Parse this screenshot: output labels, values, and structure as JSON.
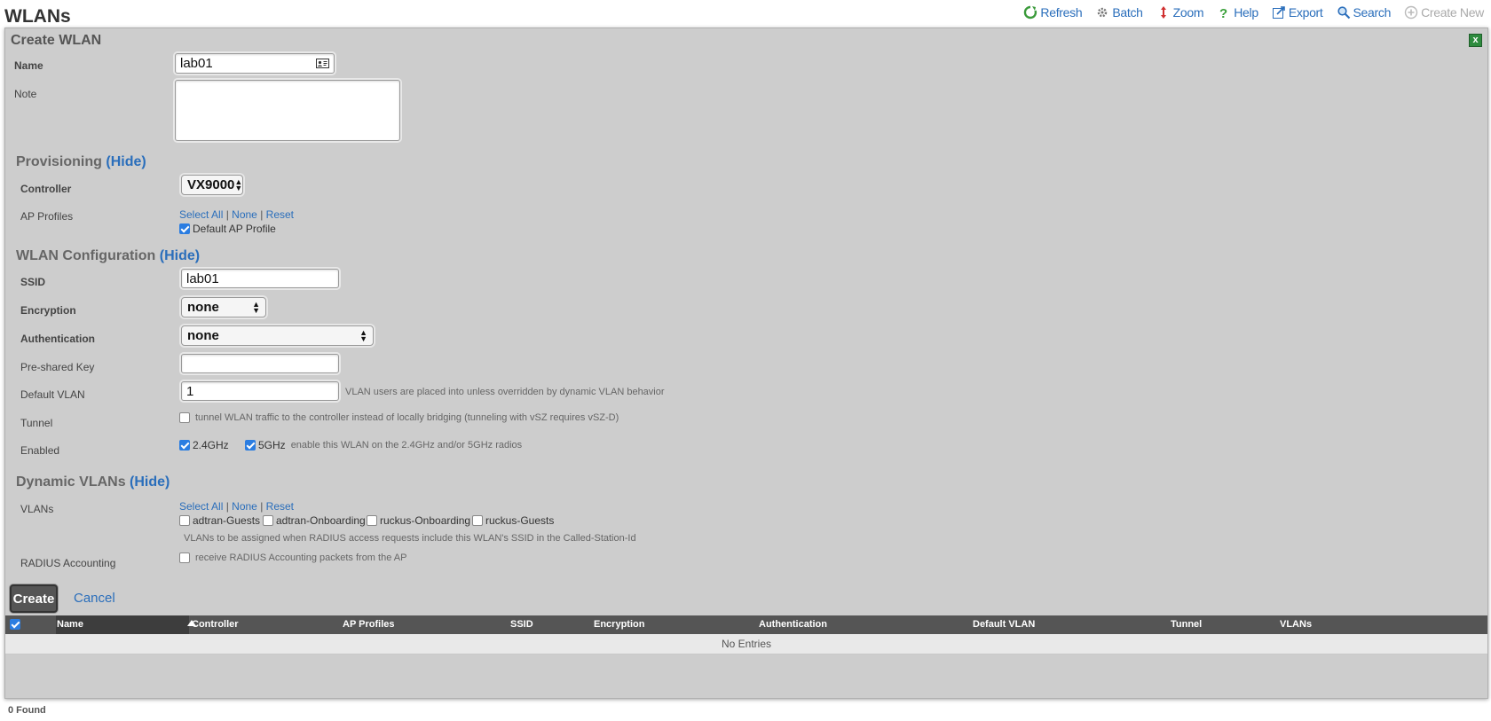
{
  "page": {
    "title": "WLANs",
    "found": "0 Found"
  },
  "toolbar": {
    "refresh": "Refresh",
    "batch": "Batch",
    "zoom": "Zoom",
    "help": "Help",
    "export": "Export",
    "search": "Search",
    "create_new": "Create New"
  },
  "form": {
    "title": "Create WLAN",
    "close": "x",
    "name_label": "Name",
    "name_value": "lab01",
    "note_label": "Note",
    "note_value": "",
    "provisioning": {
      "heading": "Provisioning",
      "hide": "(Hide)",
      "controller_label": "Controller",
      "controller_value": "VX9000",
      "ap_profiles_label": "AP Profiles",
      "select_all": "Select All",
      "sep": "|",
      "none": "None",
      "reset": "Reset",
      "default_profile": "Default AP Profile",
      "default_profile_checked": true
    },
    "wlan_config": {
      "heading": "WLAN Configuration",
      "hide": "(Hide)",
      "ssid_label": "SSID",
      "ssid_value": "lab01",
      "encryption_label": "Encryption",
      "encryption_value": "none",
      "authentication_label": "Authentication",
      "authentication_value": "none",
      "psk_label": "Pre-shared Key",
      "psk_value": "",
      "default_vlan_label": "Default VLAN",
      "default_vlan_value": "1",
      "default_vlan_hint": "VLAN users are placed into unless overridden by dynamic VLAN behavior",
      "tunnel_label": "Tunnel",
      "tunnel_hint": "tunnel WLAN traffic to the controller instead of locally bridging (tunneling with vSZ requires vSZ-D)",
      "enabled_label": "Enabled",
      "band_24": "2.4GHz",
      "band_5": "5GHz",
      "enabled_hint": "enable this WLAN on the 2.4GHz and/or 5GHz radios"
    },
    "dynamic_vlans": {
      "heading": "Dynamic VLANs",
      "hide": "(Hide)",
      "vlans_label": "VLANs",
      "select_all": "Select All",
      "sep": "|",
      "none": "None",
      "reset": "Reset",
      "options": [
        "adtran-Guests",
        "adtran-Onboarding",
        "ruckus-Onboarding",
        "ruckus-Guests"
      ],
      "vlans_hint": "VLANs to be assigned when RADIUS access requests include this WLAN's SSID in the Called-Station-Id",
      "radius_label": "RADIUS Accounting",
      "radius_hint": "receive RADIUS Accounting packets from the AP"
    },
    "create_button": "Create",
    "cancel_button": "Cancel"
  },
  "table": {
    "columns": [
      "Name",
      "Controller",
      "AP Profiles",
      "SSID",
      "Encryption",
      "Authentication",
      "Default VLAN",
      "Tunnel",
      "VLANs"
    ],
    "empty": "No Entries"
  },
  "colors": {
    "accent": "#2a6ebb",
    "panel": "#cdcdcd",
    "table_header": "#555555"
  }
}
